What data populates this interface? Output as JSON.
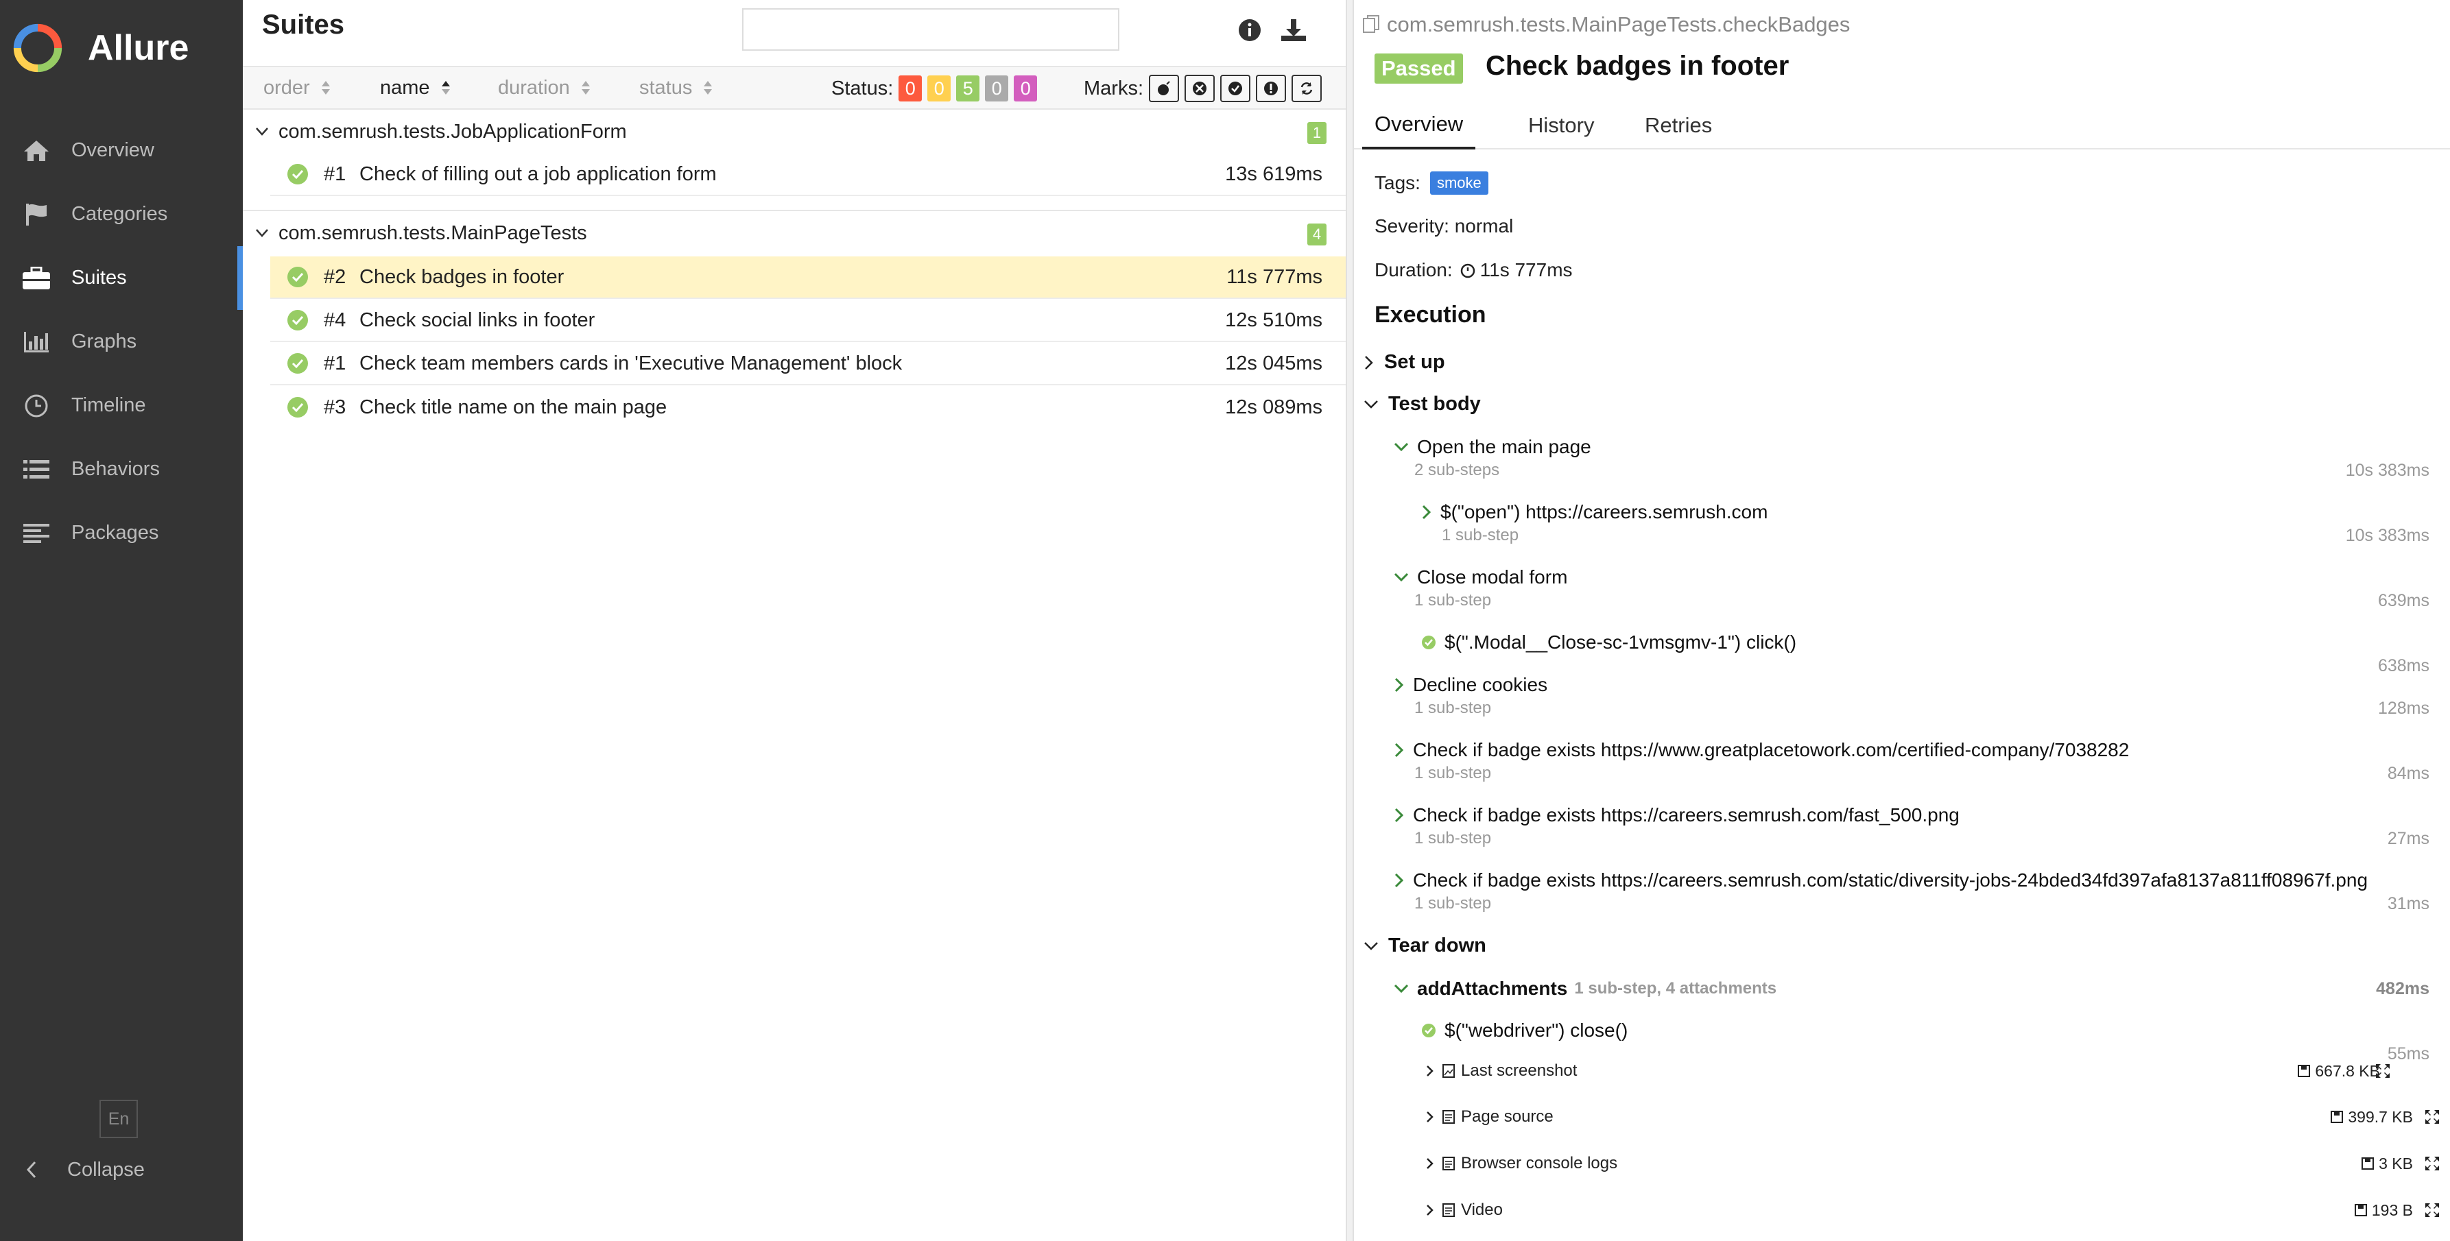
{
  "app": {
    "name": "Allure"
  },
  "sidebar": {
    "items": [
      {
        "label": "Overview",
        "icon": "home-icon"
      },
      {
        "label": "Categories",
        "icon": "flag-icon"
      },
      {
        "label": "Suites",
        "icon": "briefcase-icon",
        "active": true
      },
      {
        "label": "Graphs",
        "icon": "bar-chart-icon"
      },
      {
        "label": "Timeline",
        "icon": "clock-icon"
      },
      {
        "label": "Behaviors",
        "icon": "list-icon"
      },
      {
        "label": "Packages",
        "icon": "align-left-icon"
      }
    ],
    "language": "En",
    "collapse_label": "Collapse"
  },
  "suites": {
    "title": "Suites",
    "search_value": "",
    "sort": {
      "order": "order",
      "name": "name",
      "duration": "duration",
      "status": "status"
    },
    "status_label": "Status:",
    "status_counts": [
      "0",
      "0",
      "5",
      "0",
      "0"
    ],
    "marks_label": "Marks:",
    "groups": [
      {
        "name": "com.semrush.tests.JobApplicationForm",
        "count": "1",
        "tests": [
          {
            "num": "#1",
            "name": "Check of filling out a job application form",
            "duration": "13s 619ms"
          }
        ]
      },
      {
        "name": "com.semrush.tests.MainPageTests",
        "count": "4",
        "tests": [
          {
            "num": "#2",
            "name": "Check badges in footer",
            "duration": "11s 777ms",
            "selected": true
          },
          {
            "num": "#4",
            "name": "Check social links in footer",
            "duration": "12s 510ms"
          },
          {
            "num": "#1",
            "name": "Check team members cards in 'Executive Management' block",
            "duration": "12s 045ms"
          },
          {
            "num": "#3",
            "name": "Check title name on the main page",
            "duration": "12s 089ms"
          }
        ]
      }
    ]
  },
  "colors": {
    "sidebar_bg": "#343434",
    "passed": "#97cc64",
    "failed": "#fd5a3e",
    "broken": "#ffd050",
    "skipped": "#aaaaaa",
    "unknown": "#d35ebe",
    "selected_row": "#fff4c6",
    "tag": "#3a7fdf"
  },
  "detail": {
    "breadcrumb": "com.semrush.tests.MainPageTests.checkBadges",
    "status": "Passed",
    "title": "Check badges in footer",
    "tabs": [
      "Overview",
      "History",
      "Retries"
    ],
    "tags_label": "Tags:",
    "tag": "smoke",
    "severity": "Severity: normal",
    "duration_label": "Duration:",
    "duration": "11s 777ms",
    "execution_title": "Execution",
    "setup_label": "Set up",
    "test_body_label": "Test body",
    "steps": [
      {
        "name": "Open the main page",
        "sub": "2 sub-steps",
        "duration": "10s 383ms"
      },
      {
        "name": "$(\"open\") https://careers.semrush.com",
        "sub": "1 sub-step",
        "duration": "10s 383ms"
      },
      {
        "name": "Close modal form",
        "sub": "1 sub-step",
        "duration": "639ms"
      },
      {
        "name": "$(\".Modal__Close-sc-1vmsgmv-1\") click()",
        "duration": "638ms"
      },
      {
        "name": "Decline cookies",
        "sub": "1 sub-step",
        "duration": "128ms"
      },
      {
        "name": "Check if badge exists https://www.greatplacetowork.com/certified-company/7038282",
        "sub": "1 sub-step",
        "duration": "84ms"
      },
      {
        "name": "Check if badge exists https://careers.semrush.com/fast_500.png",
        "sub": "1 sub-step",
        "duration": "27ms"
      },
      {
        "name": "Check if badge exists https://careers.semrush.com/static/diversity-jobs-24bded34fd397afa8137a811ff08967f.png",
        "sub": "1 sub-step",
        "duration": "31ms"
      }
    ],
    "teardown_label": "Tear down",
    "teardown": {
      "name": "addAttachments",
      "info": "1 sub-step, 4 attachments",
      "duration": "482ms",
      "substep": "$(\"webdriver\") close()",
      "substep_duration": "55ms",
      "attachments": [
        {
          "name": "Last screenshot",
          "size": "667.8 KB"
        },
        {
          "name": "Page source",
          "size": "399.7 KB"
        },
        {
          "name": "Browser console logs",
          "size": "3 KB"
        },
        {
          "name": "Video",
          "size": "193 B"
        }
      ]
    }
  }
}
